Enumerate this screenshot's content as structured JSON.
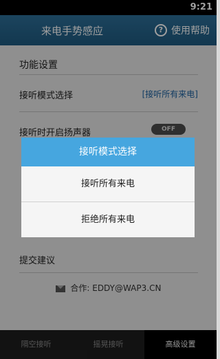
{
  "status": {
    "time": "9:21"
  },
  "title": {
    "text": "来电手势感应",
    "help": "使用帮助"
  },
  "settings": {
    "section_header": "功能设置",
    "answer_mode_label": "接听模式选择",
    "answer_mode_value": "[接听所有来电]",
    "speaker_label": "接听时开启扬声器",
    "speaker_toggle": "OFF",
    "feedback_label": "提交建议",
    "contact_text": "合作: EDDY@WAP3.CN"
  },
  "tabs": [
    "隔空接听",
    "摇晃接听",
    "高级设置"
  ],
  "dialog": {
    "title": "接听模式选择",
    "options": [
      "接听所有来电",
      "拒绝所有来电"
    ]
  }
}
